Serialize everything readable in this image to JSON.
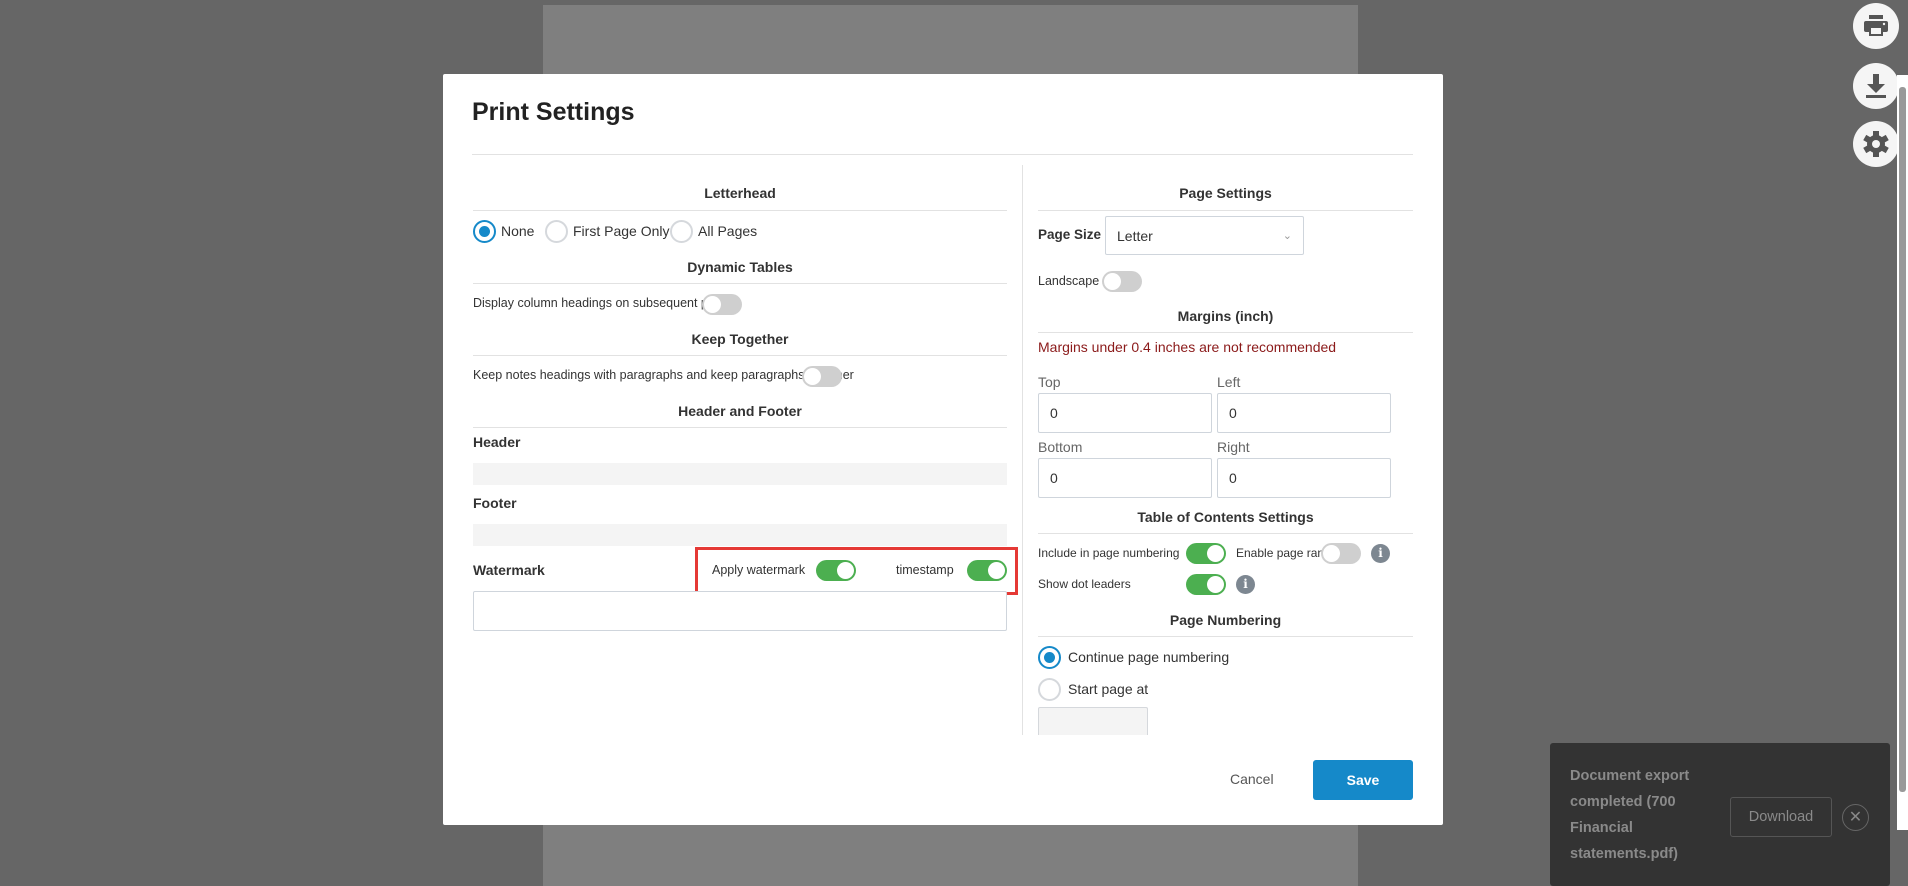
{
  "dialog": {
    "title": "Print Settings",
    "letterhead": {
      "heading": "Letterhead",
      "options": [
        "None",
        "First Page Only",
        "All Pages"
      ],
      "selected": "None"
    },
    "dynamic_tables": {
      "heading": "Dynamic Tables",
      "toggle_label": "Display column headings on subsequent pages",
      "enabled": false
    },
    "keep_together": {
      "heading": "Keep Together",
      "toggle_label": "Keep notes headings with paragraphs and keep paragraphs together",
      "enabled": false
    },
    "header_footer": {
      "heading": "Header and Footer",
      "header_label": "Header",
      "footer_label": "Footer"
    },
    "watermark": {
      "label": "Watermark",
      "apply_label": "Apply watermark",
      "apply": true,
      "timestamp_label": "timestamp",
      "timestamp": true,
      "value": ""
    },
    "page_settings": {
      "heading": "Page Settings",
      "page_size_label": "Page Size",
      "page_size": "Letter",
      "landscape_label": "Landscape",
      "landscape": false
    },
    "margins": {
      "heading": "Margins (inch)",
      "warning": "Margins under 0.4 inches are not recommended",
      "top_label": "Top",
      "top": "0",
      "left_label": "Left",
      "left": "0",
      "bottom_label": "Bottom",
      "bottom": "0",
      "right_label": "Right",
      "right": "0"
    },
    "toc": {
      "heading": "Table of Contents Settings",
      "include_label": "Include in page numbering",
      "include": true,
      "range_label": "Enable page range",
      "range": false,
      "dots_label": "Show dot leaders",
      "dots": true
    },
    "page_numbering": {
      "heading": "Page Numbering",
      "continue_label": "Continue page numbering",
      "start_label": "Start page at",
      "selected": "continue",
      "start_value": ""
    },
    "cancel_label": "Cancel",
    "save_label": "Save"
  },
  "toast": {
    "message": "Document export completed (700 Financial statements.pdf)",
    "download_label": "Download"
  },
  "colors": {
    "accent": "#1589c9",
    "toggle_on": "#4caf50",
    "warning": "#8b1a1a",
    "highlight": "#e53935"
  }
}
